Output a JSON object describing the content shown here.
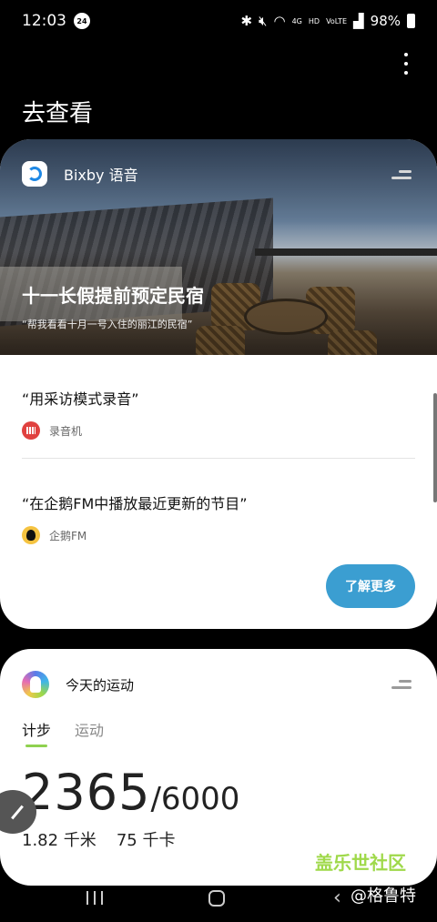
{
  "status_bar": {
    "time": "12:03",
    "badge": "24",
    "network": "4G",
    "hd": "HD",
    "volte": "VoLTE",
    "battery": "98%"
  },
  "header": {
    "title": "去查看"
  },
  "bixby_card": {
    "app_name": "Bixby 语音",
    "hero_title": "十一长假提前预定民宿",
    "hero_subtitle": "“帮我看看十月一号入住的丽江的民宿”",
    "commands": [
      {
        "text": "“用采访模式录音”",
        "app": "录音机",
        "icon": "recorder-icon"
      },
      {
        "text": "“在企鹅FM中播放最近更新的节目”",
        "app": "企鹅FM",
        "icon": "penguin-fm-icon"
      }
    ],
    "learn_more_label": "了解更多"
  },
  "fitness_card": {
    "title": "今天的运动",
    "tabs": [
      "计步",
      "运动"
    ],
    "active_tab": "计步",
    "steps": "2365",
    "goal": "/6000",
    "distance": "1.82 千米",
    "calories": "75 千卡"
  },
  "watermark": {
    "top": "盖乐世社区",
    "bottom": "@格鲁特"
  },
  "colors": {
    "accent_blue": "#3b9ed1",
    "tab_indicator": "#8fd14f",
    "recorder": "#e0413f"
  }
}
